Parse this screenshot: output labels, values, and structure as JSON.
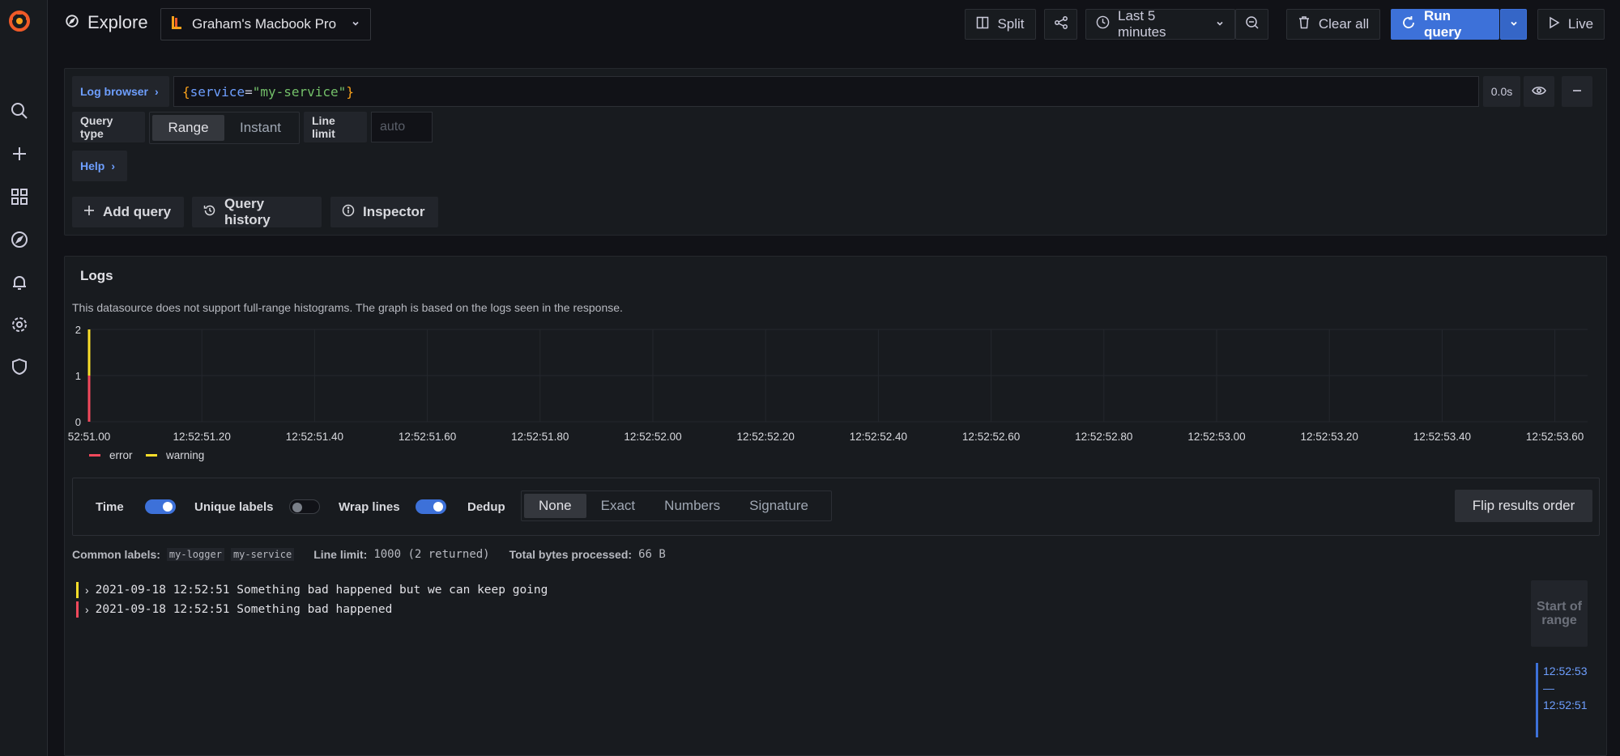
{
  "topbar": {
    "title": "Explore",
    "datasource": "Graham's Macbook Pro",
    "split": "Split",
    "time_range": "Last 5 minutes",
    "clear_all": "Clear all",
    "run_query": "Run query",
    "live": "Live"
  },
  "query": {
    "log_browser": "Log browser",
    "expr_open": "{",
    "expr_key": "service",
    "expr_eq": "=",
    "expr_value": "\"my-service\"",
    "expr_close": "}",
    "duration": "0.0s",
    "query_type_label": "Query type",
    "query_types": [
      "Range",
      "Instant"
    ],
    "line_limit_label": "Line limit",
    "line_limit_placeholder": "auto",
    "help": "Help",
    "add_query": "Add query",
    "query_history": "Query history",
    "inspector": "Inspector"
  },
  "logs": {
    "title": "Logs",
    "note": "This datasource does not support full-range histograms. The graph is based on the logs seen in the response.",
    "options": {
      "time": "Time",
      "unique_labels": "Unique labels",
      "wrap_lines": "Wrap lines",
      "dedup": "Dedup",
      "dedup_options": [
        "None",
        "Exact",
        "Numbers",
        "Signature"
      ],
      "flip": "Flip results order"
    },
    "meta": {
      "common_labels_key": "Common labels:",
      "labels": [
        "my-logger",
        "my-service"
      ],
      "line_limit_key": "Line limit:",
      "line_limit_value": "1000 (2 returned)",
      "bytes_key": "Total bytes processed:",
      "bytes_value": "66 B"
    },
    "rows": [
      {
        "text": "2021-09-18 12:52:51 Something bad happened but we can keep going",
        "level_color": "#fade2a"
      },
      {
        "text": "2021-09-18 12:52:51 Something bad happened",
        "level_color": "#f2495c"
      }
    ],
    "start_of_range": "Start of range",
    "range_from": "12:52:53",
    "range_dash": "—",
    "range_to": "12:52:51"
  },
  "chart_data": {
    "type": "bar",
    "x": [
      "52:51.00",
      "12:52:51.20",
      "12:52:51.40",
      "12:52:51.60",
      "12:52:51.80",
      "12:52:52.00",
      "12:52:52.20",
      "12:52:52.40",
      "12:52:52.60",
      "12:52:52.80",
      "12:52:53.00",
      "12:52:53.20",
      "12:52:53.40",
      "12:52:53.60"
    ],
    "yticks": [
      0,
      1,
      2
    ],
    "ylim": [
      0,
      2
    ],
    "stacked": true,
    "series": [
      {
        "name": "error",
        "color": "#f2495c",
        "values": [
          1,
          0,
          0,
          0,
          0,
          0,
          0,
          0,
          0,
          0,
          0,
          0,
          0,
          0
        ]
      },
      {
        "name": "warning",
        "color": "#fade2a",
        "values": [
          1,
          0,
          0,
          0,
          0,
          0,
          0,
          0,
          0,
          0,
          0,
          0,
          0,
          0
        ]
      }
    ],
    "grid": true,
    "legend": "bottom-left"
  }
}
